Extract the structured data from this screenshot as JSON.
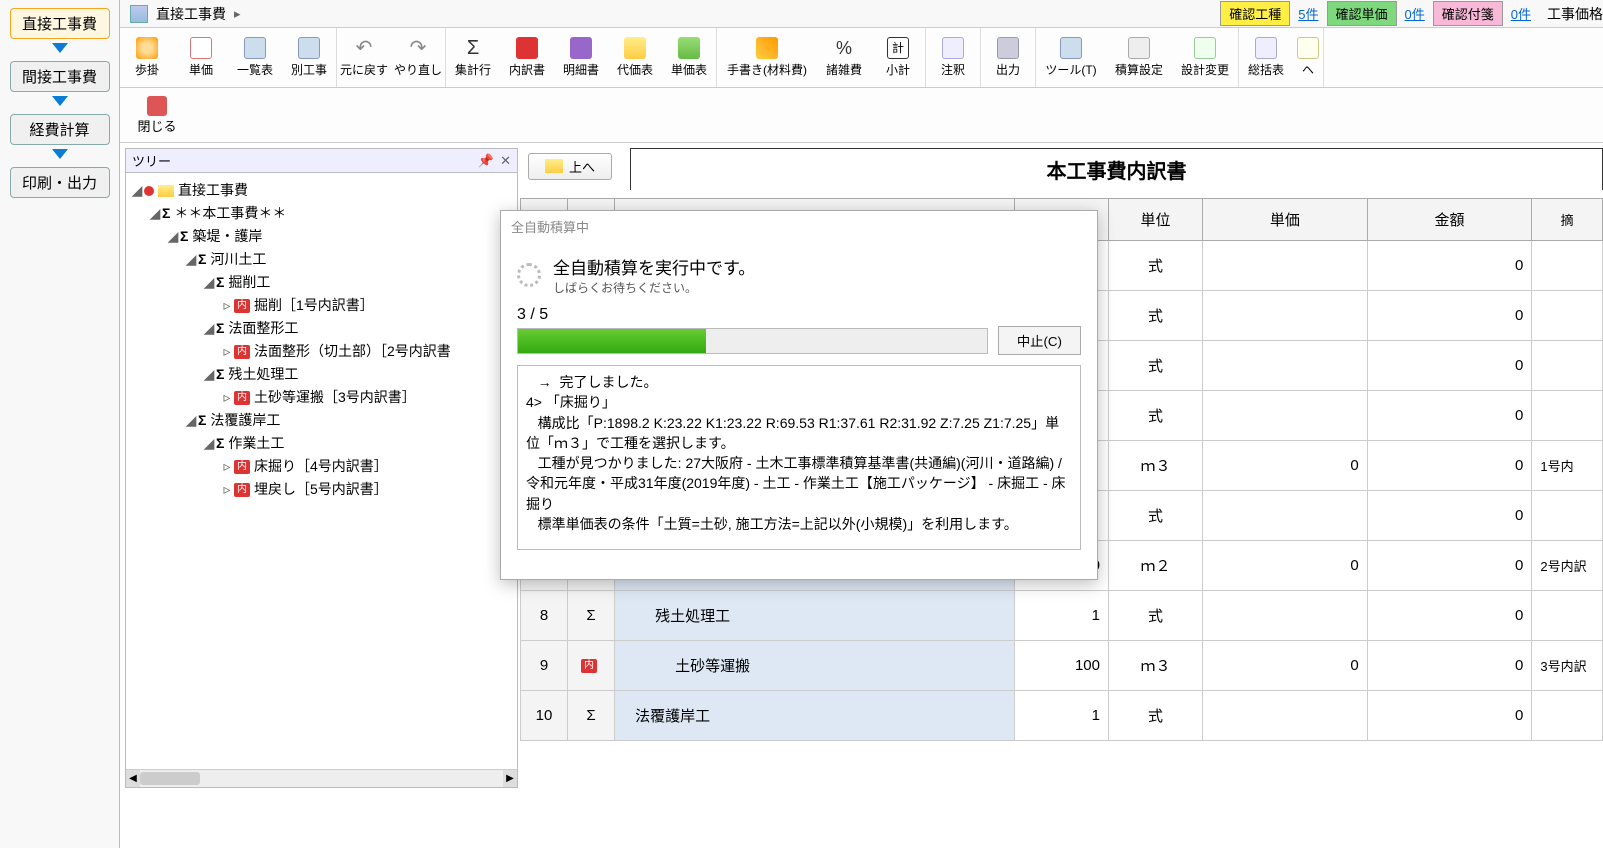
{
  "breadcrumb": {
    "label": "直接工事費",
    "caret": "▸"
  },
  "status": {
    "chip1": "確認工種",
    "link1": "5件",
    "chip2": "確認単価",
    "link2": "0件",
    "chip3": "確認付箋",
    "link3": "0件",
    "end": "工事価格"
  },
  "leftnav": {
    "b1": "直接工事費",
    "b2": "間接工事費",
    "b3": "経費計算",
    "b4": "印刷・出力"
  },
  "ribbon": {
    "r1": "歩掛",
    "r2": "単価",
    "r3": "一覧表",
    "r4": "別工事",
    "r5": "元に戻す",
    "r6": "やり直し",
    "r7": "集計行",
    "r8": "内訳書",
    "r9": "明細書",
    "r10": "代価表",
    "r11": "単価表",
    "r12": "手書き(材料費)",
    "r13": "諸雑費",
    "r14": "小計",
    "r15": "注釈",
    "r16": "出力",
    "r17": "ツール(T)",
    "r18": "積算設定",
    "r19": "設計変更",
    "r20": "総括表",
    "r21": "ヘ",
    "close": "閉じる"
  },
  "tree": {
    "header": "ツリー",
    "root": "直接工事費",
    "n1": "＊＊本工事費＊＊",
    "n2": "築堤・護岸",
    "n3": "河川土工",
    "n4": "掘削工",
    "n4a": "掘削［1号内訳書］",
    "n5": "法面整形工",
    "n5a": "法面整形（切土部）［2号内訳書",
    "n6": "残土処理工",
    "n6a": "土砂等運搬［3号内訳書］",
    "n7": "法覆護岸工",
    "n8": "作業土工",
    "n8a": "床掘り［4号内訳書］",
    "n8b": "埋戻し［5号内訳書］"
  },
  "main": {
    "up": "上へ",
    "title": "本工事費内訳書",
    "headers": {
      "unit": "単位",
      "price": "単価",
      "amount": "金額",
      "note": "摘"
    }
  },
  "rows": {
    "r1": {
      "unit": "式",
      "amt": "0"
    },
    "r2": {
      "unit": "式",
      "amt": "0"
    },
    "r3": {
      "unit": "式",
      "amt": "0"
    },
    "r4": {
      "unit": "式",
      "amt": "0"
    },
    "r5": {
      "unit": "ｍ３",
      "price": "0",
      "amt": "0",
      "note": "1号内"
    },
    "r6": {
      "unit": "式",
      "amt": "0"
    },
    "r7": {
      "num": "",
      "qty": "100",
      "unit": "ｍ２",
      "price": "0",
      "amt": "0",
      "note": "2号内訳"
    },
    "r8": {
      "num": "8",
      "name": "残土処理工",
      "qty": "1",
      "unit": "式",
      "amt": "0"
    },
    "r9": {
      "num": "9",
      "name": "土砂等運搬",
      "qty": "100",
      "unit": "ｍ３",
      "price": "0",
      "amt": "0",
      "note": "3号内訳"
    },
    "r10": {
      "num": "10",
      "name": "法覆護岸工",
      "qty": "1",
      "unit": "式",
      "amt": "0"
    }
  },
  "modal": {
    "title": "全自動積算中",
    "big": "全自動積算を実行中です。",
    "sub": "しばらくお待ちください。",
    "count": "3 / 5",
    "cancel": "中止(C)",
    "log": "   →  完了しました。\n4> 「床掘り」\n   構成比「P:1898.2 K:23.22 K1:23.22 R:69.53 R1:37.61 R2:31.92 Z:7.25 Z1:7.25」単位「ｍ３」で工種を選択します。\n   工種が見つかりました: 27大阪府 - 土木工事標準積算基準書(共通編)(河川・道路編) / 令和元年度・平成31年度(2019年度) - 土工 - 作業土工【施工パッケージ】 - 床掘工 - 床掘り\n   標準単価表の条件「土質=土砂, 施工方法=上記以外(小規模)」を利用します。\n"
  }
}
